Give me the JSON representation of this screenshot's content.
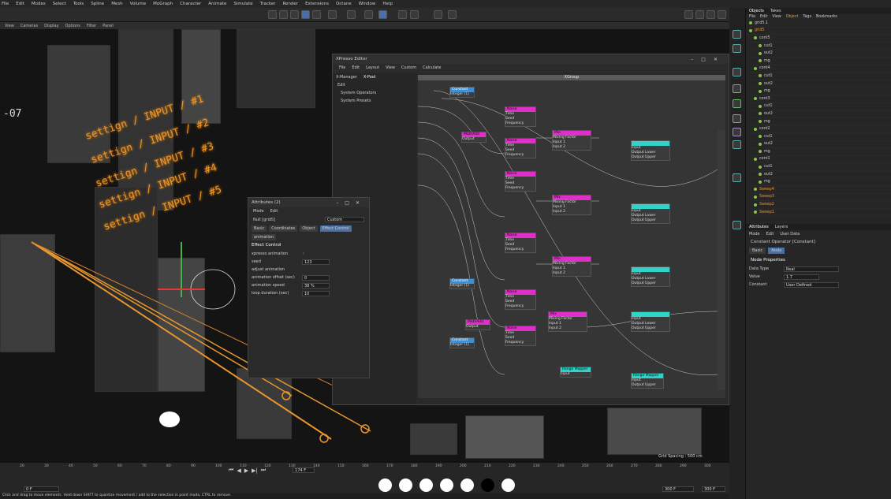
{
  "menu": [
    "File",
    "Edit",
    "Modes",
    "Select",
    "Tools",
    "Spline",
    "Mesh",
    "Volume",
    "MoGraph",
    "Character",
    "Animate",
    "Simulate",
    "Tracker",
    "Render",
    "Extensions",
    "Octane",
    "Window",
    "Help"
  ],
  "viewport_menu": [
    "View",
    "Cameras",
    "Display",
    "Options",
    "Filter",
    "Panel"
  ],
  "viewport": {
    "labels": [
      "settign / INPUT / #1",
      "settign / INPUT / #2",
      "settign / INPUT / #3",
      "settign / INPUT / #4",
      "settign / INPUT / #5"
    ],
    "grid_spacing": "Grid Spacing : 500 cm",
    "left_num": "-07"
  },
  "xpresso": {
    "title": "XPresso Editor",
    "menu": [
      "File",
      "Edit",
      "Layout",
      "View",
      "Custom",
      "Calculate"
    ],
    "tabs": [
      "X-Manager",
      "X-Pool"
    ],
    "edit": "Edit",
    "pool": [
      "System Operators",
      "System Presets"
    ],
    "xgroup": "XGroup",
    "nodes": {
      "noise": "Noise",
      "mix": "Mix",
      "constant": "Constant",
      "mathadd": "MathAdd",
      "time": "Time",
      "seed": "Seed",
      "frequency": "Frequency",
      "noise_port": "Noise",
      "output": "Output",
      "mixing": "Mixing Factor",
      "input1": "Input 1",
      "input2": "Input 2",
      "integer": "Integer (1)",
      "input": "Input",
      "output_lower": "Output Lower",
      "output_upper": "Output Upper",
      "in_output": "In Output",
      "range_mapper": "Range Mapper"
    }
  },
  "attributes": {
    "title": "Attributes (2)",
    "menu": [
      "Mode",
      "Edit"
    ],
    "object": "Null [grid5]",
    "custom": "Custom",
    "tabs": [
      "Basic",
      "Coordinates",
      "Object",
      "Effect Control"
    ],
    "subtab": "animation",
    "section": "Effect Control",
    "rows": [
      {
        "label": "xpresso animation",
        "value": "✓"
      },
      {
        "label": "seed",
        "value": "123"
      },
      {
        "label": "adjust animation",
        "value": ""
      },
      {
        "label": "animation offset (sec)",
        "value": "0"
      },
      {
        "label": "animation speed",
        "value": "38 %"
      },
      {
        "label": "loop duration (sec)",
        "value": "10"
      }
    ]
  },
  "objects": {
    "tabs": [
      "Objects",
      "Takes"
    ],
    "menu": [
      "File",
      "Edit",
      "View",
      "Object",
      "Tags",
      "Bookmarks"
    ],
    "items": [
      "grid5.1",
      "grid5",
      "cont5",
      "cut1",
      "out2",
      "mg",
      "cont4",
      "cut1",
      "out2",
      "mg",
      "cont3",
      "cut1",
      "out2",
      "mg",
      "cont2",
      "cut1",
      "out2",
      "mg",
      "cont1",
      "cut1",
      "out2",
      "mg",
      "Sweep4",
      "Sweep3",
      "Sweep2",
      "Sweep1"
    ]
  },
  "attr_panel": {
    "tabs": [
      "Attributes",
      "Layers"
    ],
    "menu": [
      "Mode",
      "Edit",
      "User Data"
    ],
    "title": "Constant Operator [Constant]",
    "tabs2": [
      "Basic",
      "Node"
    ],
    "section": "Node Properties",
    "props": [
      {
        "label": "Data Type",
        "value": "Real"
      },
      {
        "label": "Value",
        "value": "1.7"
      },
      {
        "label": "Constant",
        "value": "User Defined"
      }
    ]
  },
  "timeline": {
    "ticks": [
      "20",
      "30",
      "40",
      "50",
      "60",
      "70",
      "80",
      "90",
      "100",
      "110",
      "120",
      "130",
      "140",
      "150",
      "160",
      "170",
      "180",
      "190",
      "200",
      "210",
      "220",
      "230",
      "240",
      "250",
      "260",
      "270",
      "280",
      "290",
      "300"
    ],
    "frame": "174 F",
    "start": "0 F",
    "end_a": "300 F",
    "end_b": "300 F"
  },
  "status": "Click and drag to move elements. Hold down SHIFT to quantize movement / add to the selection in point mode, CTRL to remove."
}
